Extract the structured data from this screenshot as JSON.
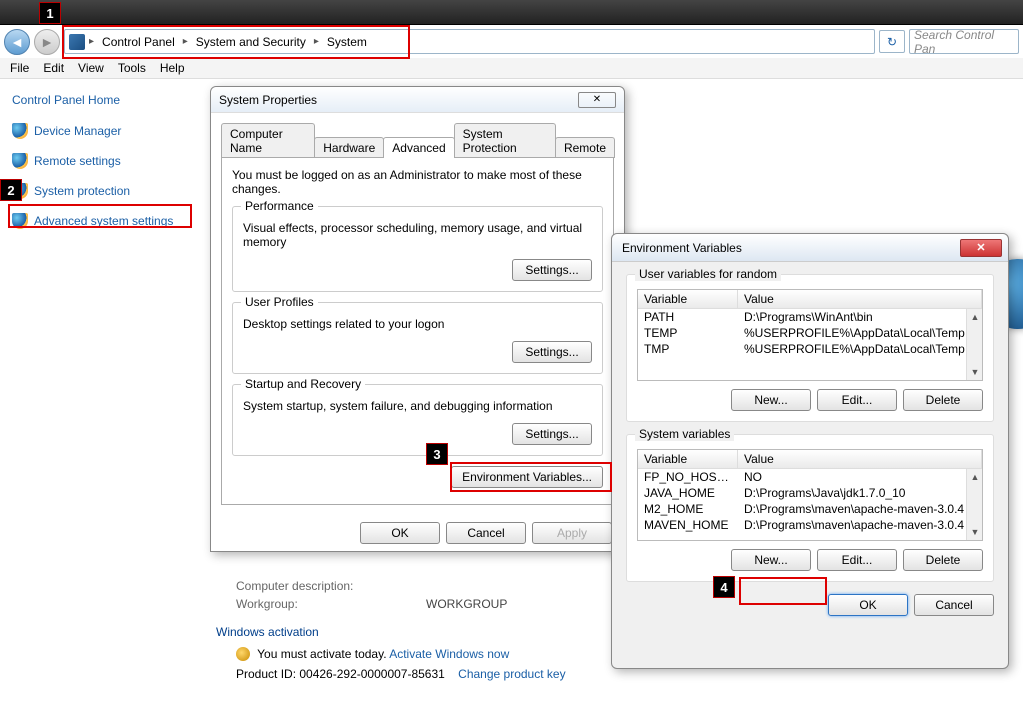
{
  "breadcrumb": {
    "items": [
      "Control Panel",
      "System and Security",
      "System"
    ]
  },
  "search": {
    "placeholder": "Search Control Pan"
  },
  "menubar": [
    "File",
    "Edit",
    "View",
    "Tools",
    "Help"
  ],
  "sidebar": {
    "home": "Control Panel Home",
    "links": [
      "Device Manager",
      "Remote settings",
      "System protection",
      "Advanced system settings"
    ]
  },
  "sysprops": {
    "title": "System Properties",
    "tabs": [
      "Computer Name",
      "Hardware",
      "Advanced",
      "System Protection",
      "Remote"
    ],
    "active_tab": "Advanced",
    "admin_note": "You must be logged on as an Administrator to make most of these changes.",
    "perf": {
      "title": "Performance",
      "desc": "Visual effects, processor scheduling, memory usage, and virtual memory",
      "btn": "Settings..."
    },
    "profiles": {
      "title": "User Profiles",
      "desc": "Desktop settings related to your logon",
      "btn": "Settings..."
    },
    "startup": {
      "title": "Startup and Recovery",
      "desc": "System startup, system failure, and debugging information",
      "btn": "Settings..."
    },
    "envbtn": "Environment Variables...",
    "ok": "OK",
    "cancel": "Cancel",
    "apply": "Apply"
  },
  "env": {
    "title": "Environment Variables",
    "userlabel": "User variables for random",
    "headers": {
      "var": "Variable",
      "val": "Value"
    },
    "uservars": [
      {
        "var": "PATH",
        "val": "D:\\Programs\\WinAnt\\bin"
      },
      {
        "var": "TEMP",
        "val": "%USERPROFILE%\\AppData\\Local\\Temp"
      },
      {
        "var": "TMP",
        "val": "%USERPROFILE%\\AppData\\Local\\Temp"
      }
    ],
    "syslabel": "System variables",
    "sysvars": [
      {
        "var": "FP_NO_HOST_C...",
        "val": "NO"
      },
      {
        "var": "JAVA_HOME",
        "val": "D:\\Programs\\Java\\jdk1.7.0_10"
      },
      {
        "var": "M2_HOME",
        "val": "D:\\Programs\\maven\\apache-maven-3.0.4"
      },
      {
        "var": "MAVEN_HOME",
        "val": "D:\\Programs\\maven\\apache-maven-3.0.4"
      }
    ],
    "new": "New...",
    "edit": "Edit...",
    "del": "Delete",
    "ok": "OK",
    "cancel": "Cancel"
  },
  "syspage": {
    "desc_lbl": "Computer description:",
    "wg_lbl": "Workgroup:",
    "wg_val": "WORKGROUP",
    "act_head": "Windows activation",
    "act_msg": "You must activate today.  ",
    "act_link": "Activate Windows now",
    "pid_lbl": "Product ID: ",
    "pid_val": "00426-292-0000007-85631",
    "change_link": "Change product key"
  },
  "callouts": {
    "c1": "1",
    "c2": "2",
    "c3": "3",
    "c4": "4"
  }
}
